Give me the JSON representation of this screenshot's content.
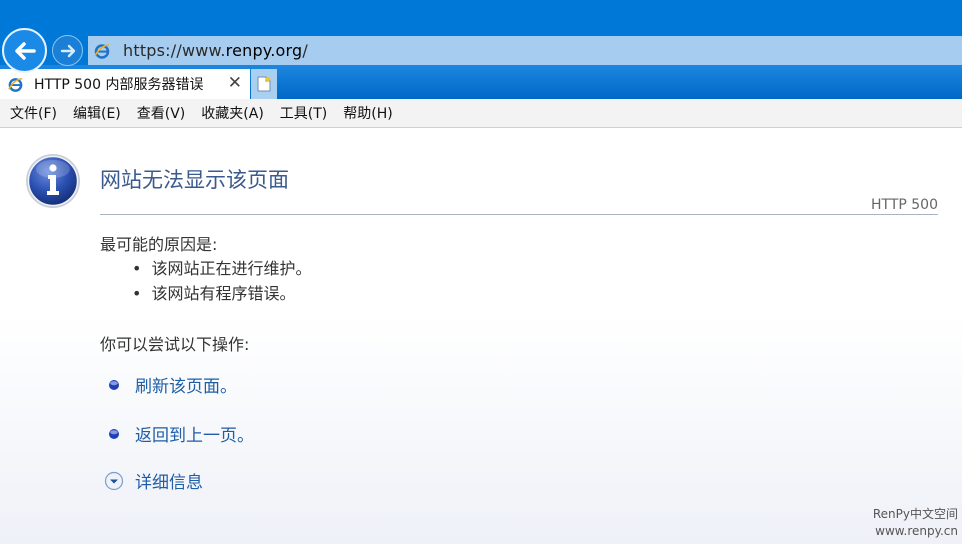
{
  "browser": {
    "address": {
      "scheme": "https://www.",
      "host": "renpy.org",
      "path": "/"
    },
    "tab": {
      "title": "HTTP 500 内部服务器错误",
      "close_glyph": "✕"
    },
    "menu": [
      "文件(F)",
      "编辑(E)",
      "查看(V)",
      "收藏夹(A)",
      "工具(T)",
      "帮助(H)"
    ]
  },
  "page": {
    "title": "网站无法显示该页面",
    "http_code": "HTTP 500",
    "cause_heading": "最可能的原因是:",
    "causes": [
      "该网站正在进行维护。",
      "该网站有程序错误。"
    ],
    "try_heading": "你可以尝试以下操作:",
    "actions": {
      "refresh": "刷新该页面。",
      "back": "返回到上一页。",
      "details": "详细信息"
    }
  },
  "watermark": {
    "line1": "RenPy中文空间",
    "line2": "www.renpy.cn"
  },
  "icons": {
    "back": "back-arrow-icon",
    "forward": "forward-arrow-icon",
    "site": "ie-logo-icon",
    "new_tab": "new-tab-icon",
    "info": "info-icon",
    "bullet": "blue-dot-icon",
    "expand": "chevron-down-circle-icon"
  },
  "colors": {
    "chrome_blue": "#0078d7",
    "address_bg": "#a6cdef",
    "title_color": "#3b5a8e",
    "link_color": "#1f5da6"
  }
}
